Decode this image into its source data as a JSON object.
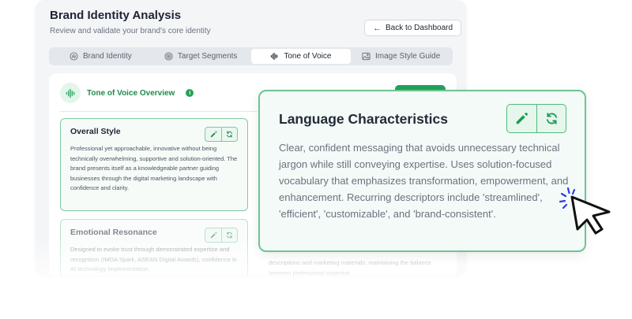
{
  "header": {
    "title": "Brand Identity Analysis",
    "subtitle": "Review and validate your brand's core identity",
    "back_button": "Back to Dashboard"
  },
  "tabs": [
    {
      "label": "Brand Identity",
      "icon": "fingerprint-icon",
      "active": false
    },
    {
      "label": "Target Segments",
      "icon": "target-icon",
      "active": false
    },
    {
      "label": "Tone of Voice",
      "icon": "audio-wave-icon",
      "active": true
    },
    {
      "label": "Image Style Guide",
      "icon": "image-icon",
      "active": false
    }
  ],
  "overview": {
    "label": "Tone of Voice Overview",
    "info_glyph": "i"
  },
  "cards": [
    {
      "title": "Overall Style",
      "body": "Professional yet approachable, innovative without being technically overwhelming, supportive and solution-oriented. The brand presents itself as a knowledgeable partner guiding businesses through the digital marketing landscape with confidence and clarity."
    },
    {
      "title": "Emotional Resonance",
      "body": "Designed to evoke trust through demonstrated expertise and recognition (IMDA Spark, ASEAN Digital Awards), confidence in AI technology implementation,"
    }
  ],
  "peek_text": "descriptions and marketing materials, maintaining the balance between professional expertise",
  "popup": {
    "title": "Language Characteristics",
    "body": "Clear, confident messaging that avoids unnecessary technical jargon while still conveying expertise. Uses solution-focused vocabulary that emphasizes transformation, empowerment, and enhancement. Recurring descriptors include 'streamlined', 'efficient', 'customizable', and 'brand-consistent'."
  },
  "colors": {
    "accent_green": "#22a35a",
    "card_border": "#7dcaa0",
    "popup_border": "#6cc593",
    "cursor_sparkle": "#2f3ce0"
  }
}
